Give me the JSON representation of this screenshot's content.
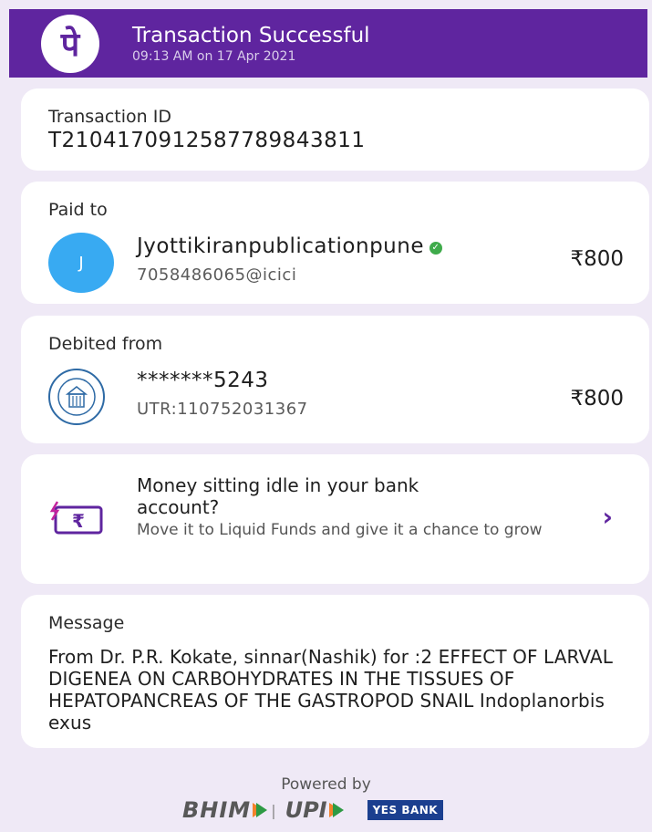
{
  "header": {
    "logo_glyph": "पे",
    "title": "Transaction Successful",
    "subtitle": "09:13 AM on 17 Apr 2021",
    "background": "#5f259f"
  },
  "transaction": {
    "label": "Transaction ID",
    "id": "T2104170912587789843811"
  },
  "paid_to": {
    "label": "Paid to",
    "avatar_initial": "J",
    "name": "Jyottikiranpublicationpune",
    "verified_icon": "verified-check-icon",
    "upi_id": "7058486065@icici",
    "amount": "₹800"
  },
  "debited_from": {
    "label": "Debited from",
    "bank_icon": "bank-emblem-icon",
    "account": "*******5243",
    "utr": "UTR:110752031367",
    "amount": "₹800"
  },
  "promo": {
    "icon": "rupee-card-icon",
    "title": "Money sitting idle in your bank account?",
    "subtitle": "Move it to Liquid Funds and give it a chance to grow",
    "chevron": "›"
  },
  "message": {
    "label": "Message",
    "text": "From Dr. P.R. Kokate, sinnar(Nashik) for :2 EFFECT OF LARVAL DIGENEA ON CARBOHYDRATES IN THE TISSUES OF HEPATOPANCREAS OF THE GASTROPOD SNAIL Indoplanorbis exus"
  },
  "footer": {
    "powered_by": "Powered by",
    "bhim": "BHIM",
    "upi": "UPI",
    "bank": "YES BANK"
  }
}
